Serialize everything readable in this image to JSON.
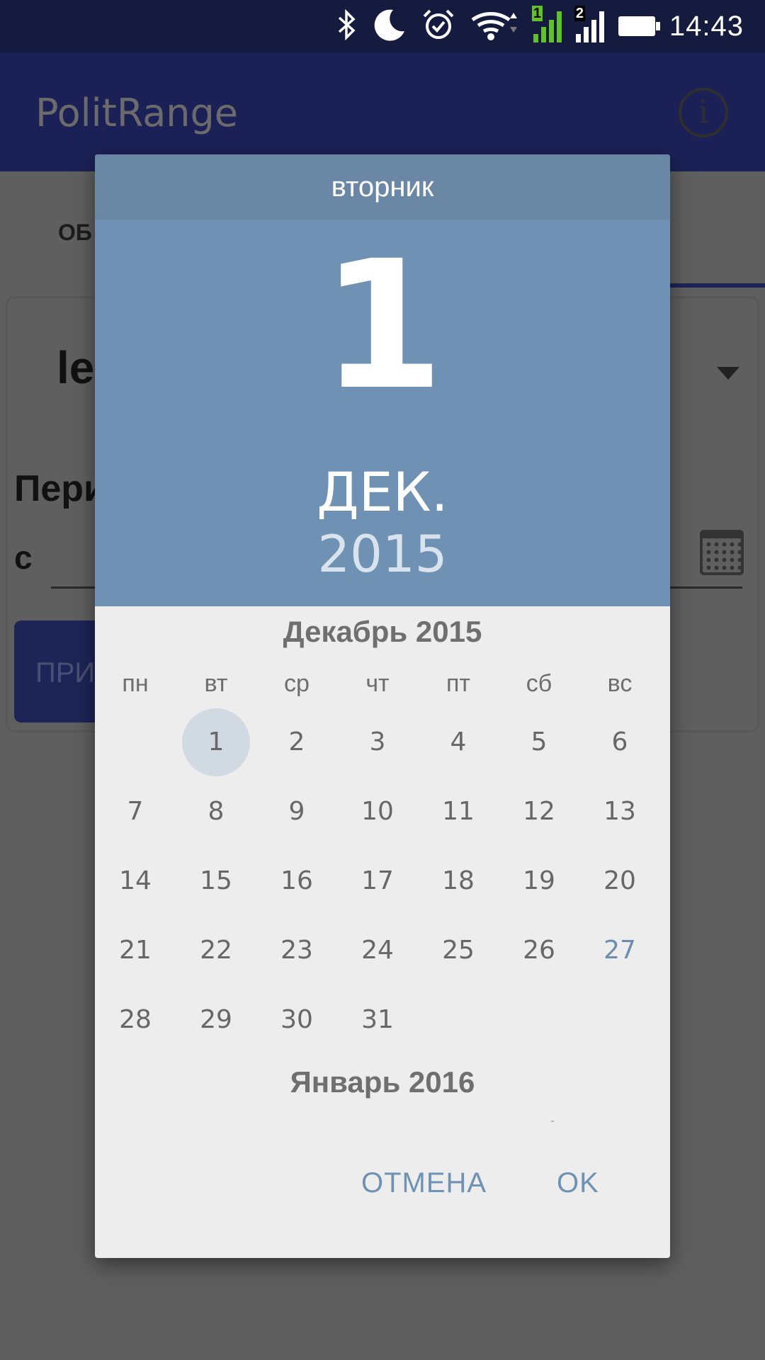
{
  "status_bar": {
    "time": "14:43",
    "sim1_label": "1",
    "sim2_label": "2",
    "icons": [
      "bluetooth-icon",
      "moon-icon",
      "alarm-icon",
      "wifi-icon",
      "signal-sim1-icon",
      "signal-sim2-icon",
      "battery-icon"
    ]
  },
  "app_bar": {
    "title": "PolitRange",
    "info_label": "i"
  },
  "background": {
    "tab_label": "ОБ",
    "select_value": "le",
    "period_label": "Пери",
    "from_label": "с",
    "button_label": "ПРИ"
  },
  "dialog": {
    "weekday": "вторник",
    "day": "1",
    "month_short": "ДЕК.",
    "year": "2015",
    "current_month_title": "Декабрь 2015",
    "next_month_title": "Январь 2016",
    "weekday_headers": [
      "пн",
      "вт",
      "ср",
      "чт",
      "пт",
      "сб",
      "вс"
    ],
    "first_weekday_index": 1,
    "days": [
      "1",
      "2",
      "3",
      "4",
      "5",
      "6",
      "7",
      "8",
      "9",
      "10",
      "11",
      "12",
      "13",
      "14",
      "15",
      "16",
      "17",
      "18",
      "19",
      "20",
      "21",
      "22",
      "23",
      "24",
      "25",
      "26",
      "27",
      "28",
      "29",
      "30",
      "31"
    ],
    "selected_day": "1",
    "today_day": "27",
    "cancel_label": "ОТМЕНА",
    "ok_label": "OK",
    "colors": {
      "header": "#6f92b4",
      "weekday_bar": "#6a87a6",
      "accent": "#6d8db0",
      "selected_bg": "#d1d9e3"
    }
  }
}
